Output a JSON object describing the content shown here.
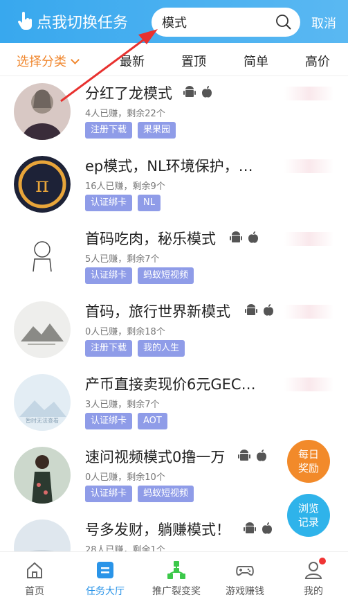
{
  "header": {
    "switch_task_label": "点我切换任务",
    "search_value": "模式",
    "cancel_label": "取消"
  },
  "filters": [
    {
      "label": "选择分类",
      "active": true
    },
    {
      "label": "最新"
    },
    {
      "label": "置顶"
    },
    {
      "label": "简单"
    },
    {
      "label": "高价"
    }
  ],
  "tasks": [
    {
      "title": "分红了龙模式",
      "meta": "4人已赚，剩余22个",
      "tags": [
        "注册下载",
        "果果园"
      ]
    },
    {
      "title": "ep模式，NL环境保护，…",
      "meta": "16人已赚，剩余9个",
      "tags": [
        "认证绑卡",
        "NL"
      ]
    },
    {
      "title": "首码吃肉，秘乐模式",
      "meta": "5人已赚，剩余7个",
      "tags": [
        "认证绑卡",
        "蚂蚁短视频"
      ]
    },
    {
      "title": "首码，旅行世界新模式",
      "meta": "0人已赚，剩余18个",
      "tags": [
        "注册下载",
        "我的人生"
      ]
    },
    {
      "title": "产币直接卖现价6元GEC…",
      "meta": "3人已赚，剩余7个",
      "tags": [
        "认证绑卡",
        "AOT"
      ],
      "avatar_caption": "暂时无法查看"
    },
    {
      "title": "速问视频模式0撸一万",
      "meta": "0人已赚，剩余10个",
      "tags": [
        "认证绑卡",
        "蚂蚁短视频"
      ]
    },
    {
      "title": "号多发财，躺赚模式！",
      "meta": "28人已赚，剩余1个",
      "tags": []
    }
  ],
  "floating": {
    "daily_reward": "每日\n奖励",
    "browse_record": "浏览\n记录"
  },
  "tabbar": [
    {
      "label": "首页"
    },
    {
      "label": "任务大厅",
      "active": true
    },
    {
      "label": "推广裂变奖"
    },
    {
      "label": "游戏赚钱"
    },
    {
      "label": "我的"
    }
  ],
  "colors": {
    "header": "#38a8ee",
    "accent_orange": "#f0872e",
    "tag_bg": "#8f9ce8",
    "tab_active": "#2a94e8"
  }
}
